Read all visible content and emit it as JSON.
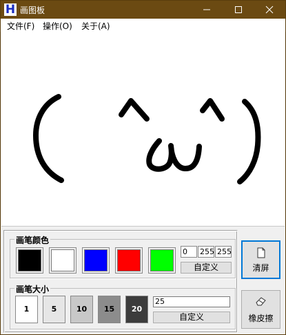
{
  "window": {
    "title": "画图板",
    "app_icon_glyph": "H",
    "controls": {
      "minimize": "—",
      "maximize": "☐",
      "close": "✕"
    }
  },
  "menu": {
    "items": [
      "文件(F)",
      "操作(O)",
      "关于(A)"
    ]
  },
  "pen_color": {
    "label": "画笔颜色",
    "swatches": [
      {
        "name": "black",
        "color": "#000000",
        "selected": false
      },
      {
        "name": "white",
        "color": "#ffffff",
        "selected": false
      },
      {
        "name": "blue",
        "color": "#0000ff",
        "selected": false
      },
      {
        "name": "red",
        "color": "#ff0000",
        "selected": false
      },
      {
        "name": "green",
        "color": "#00ff00",
        "selected": false
      }
    ],
    "rgb": [
      "0",
      "255",
      "255"
    ],
    "custom_button": "自定义"
  },
  "pen_size": {
    "label": "画笔大小",
    "presets": [
      {
        "label": "1",
        "bg": "#ffffff",
        "fg": "#000000"
      },
      {
        "label": "5",
        "bg": "#e6e6e6",
        "fg": "#000000"
      },
      {
        "label": "10",
        "bg": "#c8c8c8",
        "fg": "#000000"
      },
      {
        "label": "15",
        "bg": "#8c8c8c",
        "fg": "#000000"
      },
      {
        "label": "20",
        "bg": "#3c3c3c",
        "fg": "#ffffff"
      }
    ],
    "value": "25",
    "custom_button": "自定义"
  },
  "actions": {
    "clear_label": "清屏",
    "eraser_label": "橡皮擦"
  },
  "colors": {
    "titlebar": "#6b4a12",
    "focus": "#0078d7",
    "stroke": "#000000"
  }
}
